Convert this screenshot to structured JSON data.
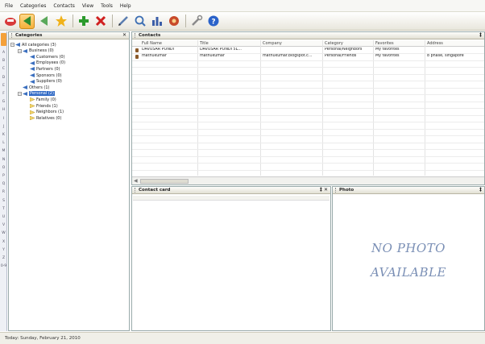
{
  "menu": [
    "File",
    "Categories",
    "Contacts",
    "View",
    "Tools",
    "Help"
  ],
  "toolbar": [
    {
      "name": "home-icon",
      "color": "#d83a3a"
    },
    {
      "name": "back-icon",
      "color": "#2f8c2f"
    },
    {
      "name": "forward-icon",
      "color": "#2f8c2f"
    },
    {
      "name": "star-icon",
      "color": "#f0b21a"
    },
    {
      "name": "add-contact-icon",
      "color": "#2c9a2c"
    },
    {
      "name": "delete-icon",
      "color": "#d02020"
    },
    {
      "name": "pen-icon",
      "color": "#5a7db0"
    },
    {
      "name": "search-icon",
      "color": "#3d6fb3"
    },
    {
      "name": "chart-icon",
      "color": "#3b5ea8"
    },
    {
      "name": "photo-icon",
      "color": "#c84a2a"
    },
    {
      "name": "tools-icon",
      "color": "#8a8a8a"
    },
    {
      "name": "help-icon",
      "color": "#2a62c9"
    }
  ],
  "alphabet": [
    "A",
    "B",
    "C",
    "D",
    "E",
    "F",
    "G",
    "H",
    "I",
    "J",
    "K",
    "L",
    "M",
    "N",
    "O",
    "P",
    "Q",
    "R",
    "S",
    "T",
    "U",
    "V",
    "W",
    "X",
    "Y",
    "Z",
    "0-9"
  ],
  "categories": {
    "title": "Categories",
    "controls": "✕",
    "tree": [
      {
        "label": "All categories (3)",
        "level": 0,
        "expanded": true
      },
      {
        "label": "Business (0)",
        "level": 1,
        "expanded": true
      },
      {
        "label": "Customers (0)",
        "level": 2
      },
      {
        "label": "Employees (0)",
        "level": 2
      },
      {
        "label": "Partners (0)",
        "level": 2
      },
      {
        "label": "Sponsors (0)",
        "level": 2
      },
      {
        "label": "Suppliers (0)",
        "level": 2
      },
      {
        "label": "Others (1)",
        "level": 1
      },
      {
        "label": "Personal (2)",
        "level": 1,
        "expanded": true,
        "selected": true
      },
      {
        "label": "Family (0)",
        "level": 2
      },
      {
        "label": "Friends (1)",
        "level": 2
      },
      {
        "label": "Neighbors (1)",
        "level": 2
      },
      {
        "label": "Relatives (0)",
        "level": 2
      }
    ]
  },
  "contacts": {
    "title": "Contacts",
    "pin": "‡",
    "columns": [
      "Full Name",
      "Title",
      "Company",
      "Category",
      "Favorites",
      "Address"
    ],
    "rows": [
      [
        "DAVUSAR PONDI",
        "DAVUSAR PONDI 5L...",
        "",
        "Personal/Neighbors",
        "My favorites",
        ""
      ],
      [
        "mathukumar",
        "mathukumar",
        "mathukumar.blogspot.c...",
        "Personal/Friends",
        "My favorites",
        "8 phase, singapore"
      ]
    ]
  },
  "contact_card": {
    "title": "Contact card",
    "controls": "‡ ✕"
  },
  "photo": {
    "title": "Photo",
    "pin": "‡",
    "line1": "NO PHOTO",
    "line2": "AVAILABLE"
  },
  "status": "Today: Sunday, February 21, 2010"
}
